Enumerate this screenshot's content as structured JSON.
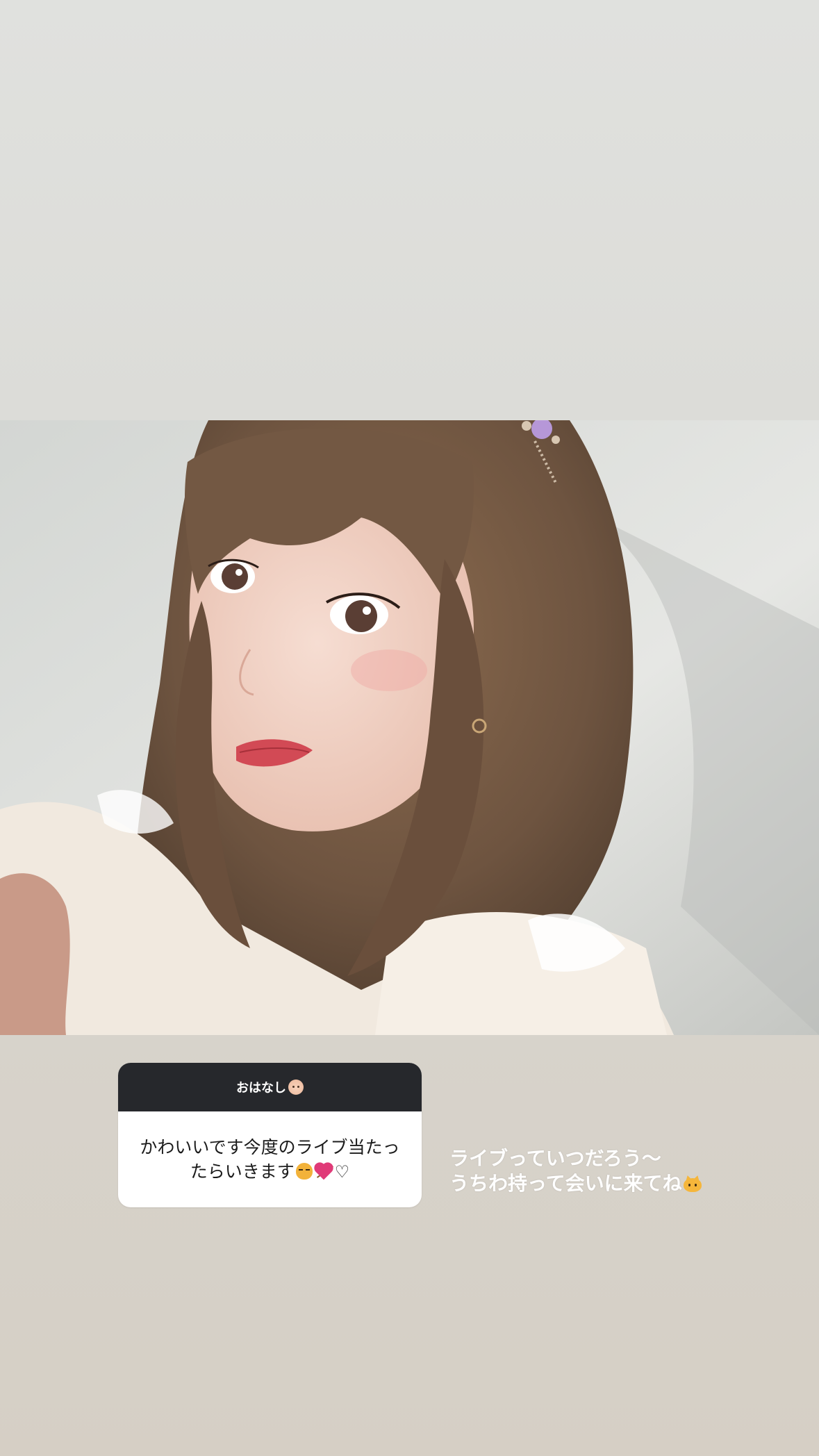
{
  "question_box": {
    "header_label": "おはなし",
    "header_icon": "baby-face-icon",
    "question_text": "かわいいです今度のライブ当たったらいきます",
    "trailing_emojis": [
      "crying-cat-icon",
      "heart-with-arrow-icon"
    ],
    "trailing_symbol": "♡"
  },
  "answer": {
    "line1": "ライブっていつだろう〜",
    "line2": "うちわ持って会いに来てね",
    "trailing_icon": "cat-face-icon"
  },
  "photo": {
    "subject": "selfie-photo"
  },
  "colors": {
    "header_bg": "#26282c",
    "card_bg": "#ffffff",
    "answer_text": "#ffffff",
    "page_top": "#e0e1dd",
    "page_bottom": "#d6cfc5"
  }
}
